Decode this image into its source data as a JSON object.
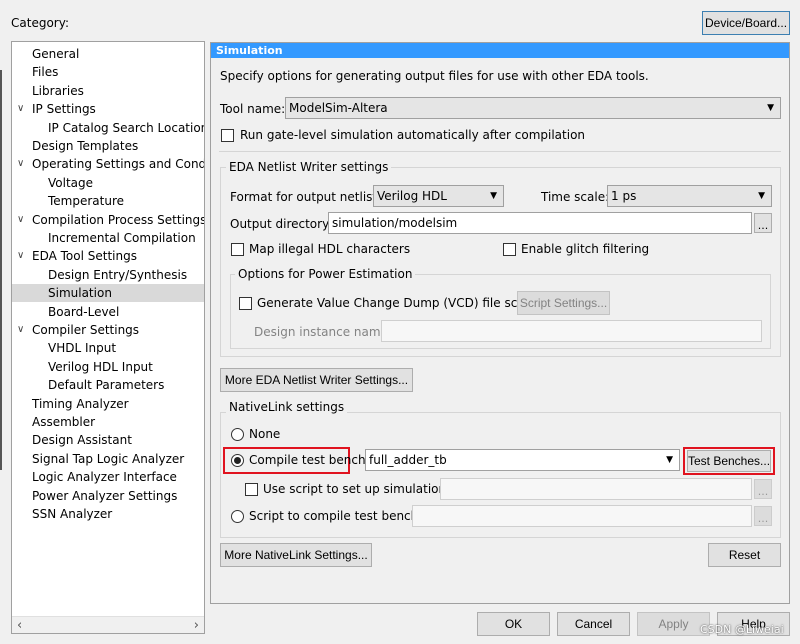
{
  "category_label": "Category:",
  "device_board_button": "Device/Board...",
  "tree": [
    {
      "label": "General",
      "level": 1,
      "expander": false,
      "selected": false
    },
    {
      "label": "Files",
      "level": 1,
      "expander": false,
      "selected": false
    },
    {
      "label": "Libraries",
      "level": 1,
      "expander": false,
      "selected": false
    },
    {
      "label": "IP Settings",
      "level": 1,
      "expander": true,
      "selected": false
    },
    {
      "label": "IP Catalog Search Locations",
      "level": 2,
      "expander": false,
      "selected": false
    },
    {
      "label": "Design Templates",
      "level": 1,
      "expander": false,
      "selected": false
    },
    {
      "label": "Operating Settings and Conditic",
      "level": 1,
      "expander": true,
      "selected": false
    },
    {
      "label": "Voltage",
      "level": 2,
      "expander": false,
      "selected": false
    },
    {
      "label": "Temperature",
      "level": 2,
      "expander": false,
      "selected": false
    },
    {
      "label": "Compilation Process Settings",
      "level": 1,
      "expander": true,
      "selected": false
    },
    {
      "label": "Incremental Compilation",
      "level": 2,
      "expander": false,
      "selected": false
    },
    {
      "label": "EDA Tool Settings",
      "level": 1,
      "expander": true,
      "selected": false
    },
    {
      "label": "Design Entry/Synthesis",
      "level": 2,
      "expander": false,
      "selected": false
    },
    {
      "label": "Simulation",
      "level": 2,
      "expander": false,
      "selected": true
    },
    {
      "label": "Board-Level",
      "level": 2,
      "expander": false,
      "selected": false
    },
    {
      "label": "Compiler Settings",
      "level": 1,
      "expander": true,
      "selected": false
    },
    {
      "label": "VHDL Input",
      "level": 2,
      "expander": false,
      "selected": false
    },
    {
      "label": "Verilog HDL Input",
      "level": 2,
      "expander": false,
      "selected": false
    },
    {
      "label": "Default Parameters",
      "level": 2,
      "expander": false,
      "selected": false
    },
    {
      "label": "Timing Analyzer",
      "level": 1,
      "expander": false,
      "selected": false
    },
    {
      "label": "Assembler",
      "level": 1,
      "expander": false,
      "selected": false
    },
    {
      "label": "Design Assistant",
      "level": 1,
      "expander": false,
      "selected": false
    },
    {
      "label": "Signal Tap Logic Analyzer",
      "level": 1,
      "expander": false,
      "selected": false
    },
    {
      "label": "Logic Analyzer Interface",
      "level": 1,
      "expander": false,
      "selected": false
    },
    {
      "label": "Power Analyzer Settings",
      "level": 1,
      "expander": false,
      "selected": false
    },
    {
      "label": "SSN Analyzer",
      "level": 1,
      "expander": false,
      "selected": false
    }
  ],
  "panel": {
    "title": "Simulation",
    "description": "Specify options for generating output files for use with other EDA tools.",
    "tool_name_label": "Tool name:",
    "tool_name_value": "ModelSim-Altera",
    "run_gate_level_label": "Run gate-level simulation automatically after compilation",
    "eda_netlist_group": "EDA Netlist Writer settings",
    "format_label": "Format for output netlist:",
    "format_value": "Verilog HDL",
    "time_scale_label": "Time scale:",
    "time_scale_value": "1 ps",
    "output_dir_label": "Output directory:",
    "output_dir_value": "simulation/modelsim",
    "map_illegal_label": "Map illegal HDL characters",
    "glitch_label": "Enable glitch filtering",
    "power_group": "Options for Power Estimation",
    "vcd_label": "Generate Value Change Dump (VCD) file script",
    "script_settings_button": "Script Settings...",
    "design_instance_label": "Design instance name:",
    "more_eda_button": "More EDA Netlist Writer Settings...",
    "nativelink_group": "NativeLink settings",
    "none_label": "None",
    "compile_tb_label": "Compile test bench:",
    "compile_tb_value": "full_adder_tb",
    "test_benches_button": "Test Benches...",
    "use_script_label": "Use script to set up simulation:",
    "script_compile_label": "Script to compile test bench:",
    "more_nativelink_button": "More NativeLink Settings...",
    "reset_button": "Reset"
  },
  "footer": {
    "ok": "OK",
    "cancel": "Cancel",
    "apply": "Apply",
    "help": "Help"
  },
  "watermark": "CSDN @Liweiai",
  "colors": {
    "accent": "#3399ff",
    "highlight": "#e0131f",
    "selection": "#d9d9d9"
  }
}
